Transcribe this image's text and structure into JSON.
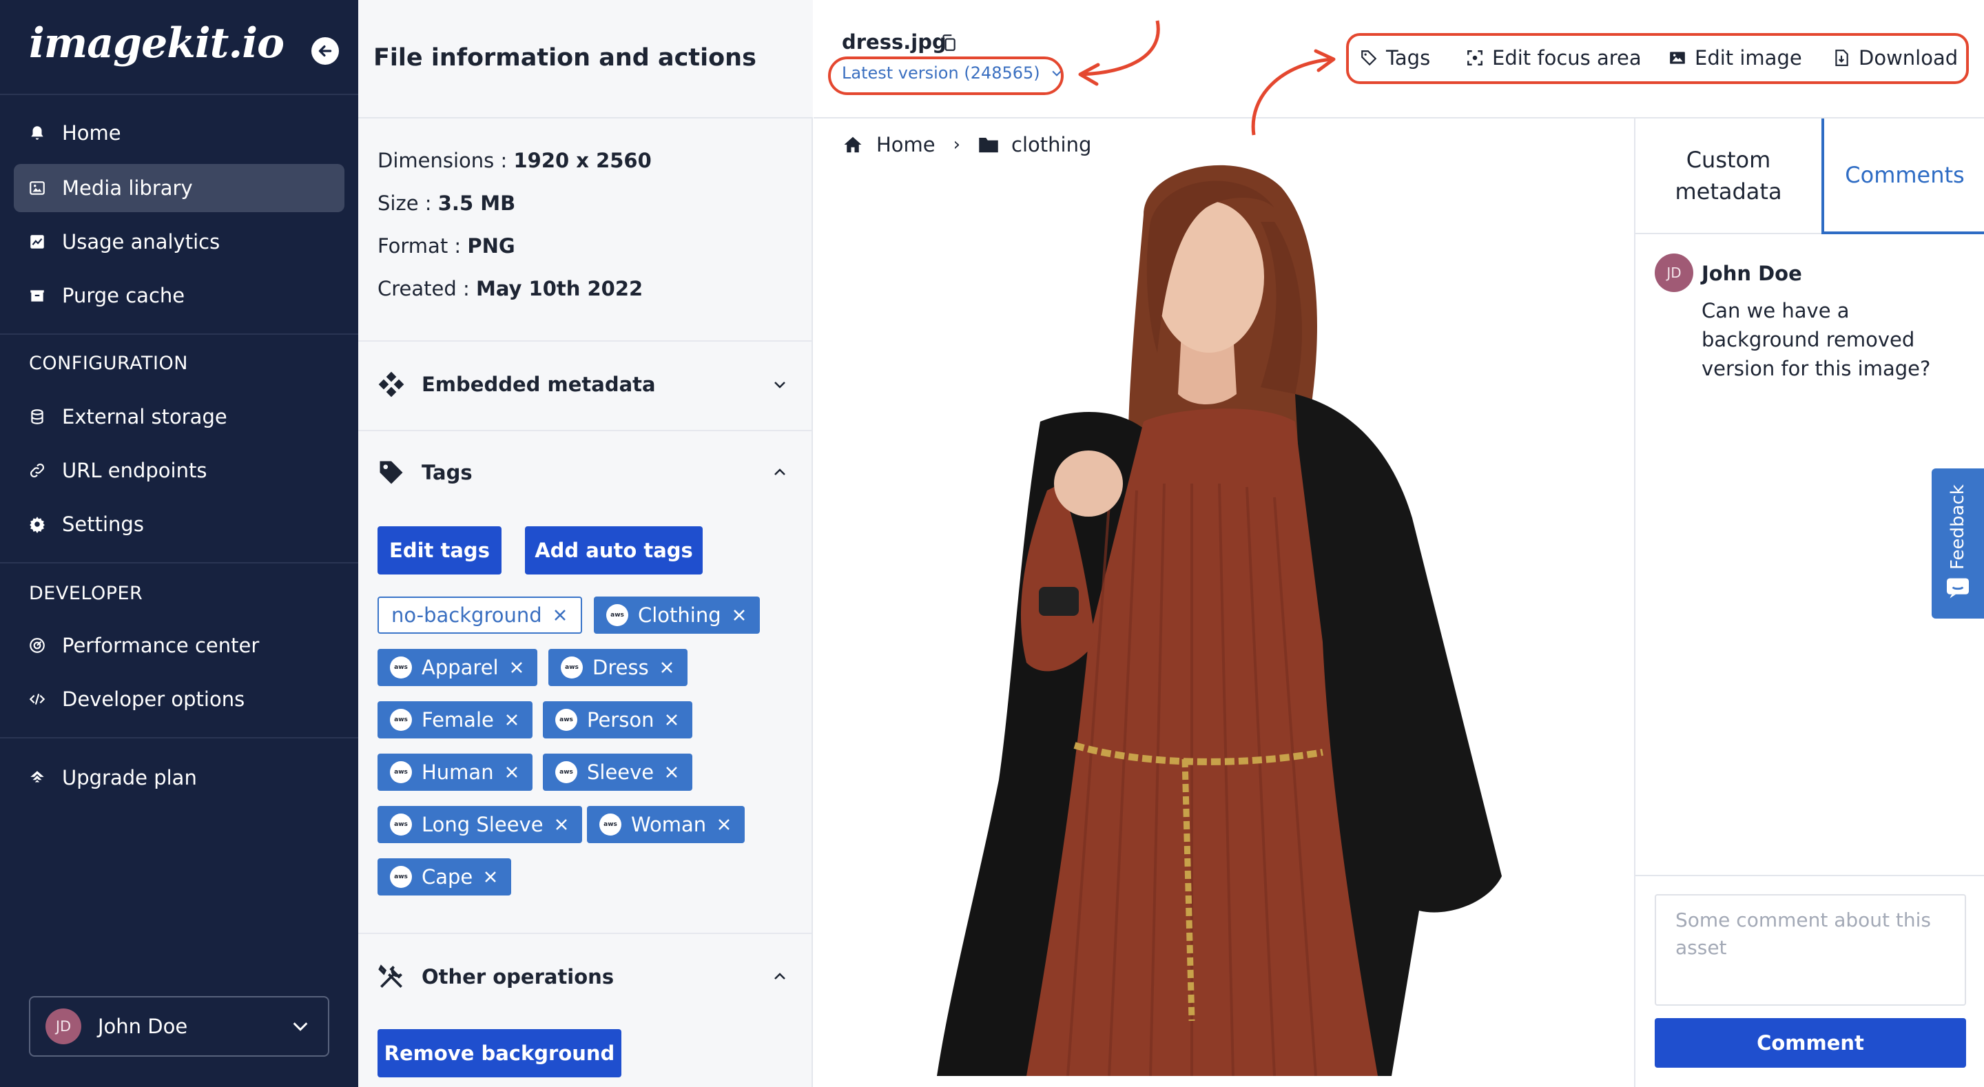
{
  "sidebar": {
    "logo": "imagekit.io",
    "nav": [
      {
        "label": "Home",
        "icon": "bell-icon",
        "active": false
      },
      {
        "label": "Media library",
        "icon": "image-gallery-icon",
        "active": true
      },
      {
        "label": "Usage analytics",
        "icon": "chart-icon",
        "active": false
      },
      {
        "label": "Purge cache",
        "icon": "cache-box-icon",
        "active": false
      }
    ],
    "configuration_label": "CONFIGURATION",
    "configuration": [
      {
        "label": "External storage",
        "icon": "database-icon"
      },
      {
        "label": "URL endpoints",
        "icon": "link-icon"
      },
      {
        "label": "Settings",
        "icon": "gear-icon"
      }
    ],
    "developer_label": "DEVELOPER",
    "developer": [
      {
        "label": "Performance center",
        "icon": "gauge-icon"
      },
      {
        "label": "Developer options",
        "icon": "code-icon"
      }
    ],
    "upgrade": {
      "label": "Upgrade plan",
      "icon": "upgrade-icon"
    },
    "user": {
      "initials": "JD",
      "name": "John Doe"
    }
  },
  "info": {
    "title": "File information and actions",
    "dimensions": {
      "label": "Dimensions : ",
      "value": "1920 x 2560"
    },
    "size": {
      "label": "Size : ",
      "value": "3.5 MB"
    },
    "format": {
      "label": "Format : ",
      "value": "PNG"
    },
    "created": {
      "label": "Created : ",
      "value": "May 10th 2022"
    },
    "embedded_metadata": "Embedded metadata",
    "tags_section": "Tags",
    "edit_tags": "Edit tags",
    "add_auto_tags": "Add auto tags",
    "aws_badge": "aws",
    "tags": [
      {
        "label": "no-background",
        "aws": false
      },
      {
        "label": "Clothing",
        "aws": true
      },
      {
        "label": "Apparel",
        "aws": true
      },
      {
        "label": "Dress",
        "aws": true
      },
      {
        "label": "Female",
        "aws": true
      },
      {
        "label": "Person",
        "aws": true
      },
      {
        "label": "Human",
        "aws": true
      },
      {
        "label": "Sleeve",
        "aws": true
      },
      {
        "label": "Long Sleeve",
        "aws": true
      },
      {
        "label": "Woman",
        "aws": true
      },
      {
        "label": "Cape",
        "aws": true
      }
    ],
    "other_operations": "Other operations",
    "remove_background": "Remove background"
  },
  "file": {
    "name": "dress.jpg",
    "version": "Latest version (248565)"
  },
  "actions": {
    "tags": "Tags",
    "edit_focus_area": "Edit focus area",
    "edit_image": "Edit image",
    "download": "Download"
  },
  "breadcrumb": {
    "home": "Home",
    "separator": "›",
    "folder": "clothing"
  },
  "comments": {
    "tab_custom": "Custom metadata",
    "tab_comments": "Comments",
    "items": [
      {
        "initials": "JD",
        "author": "John Doe",
        "text": "Can we have a background removed version for this image?"
      }
    ],
    "placeholder": "Some comment about this asset",
    "submit": "Comment"
  },
  "feedback": "Feedback",
  "colors": {
    "sidebar_bg": "#17223f",
    "primary_blue": "#1f4fce",
    "tag_blue": "#3a75c9",
    "highlight_red": "#e4472f",
    "avatar": "#a05a75"
  }
}
